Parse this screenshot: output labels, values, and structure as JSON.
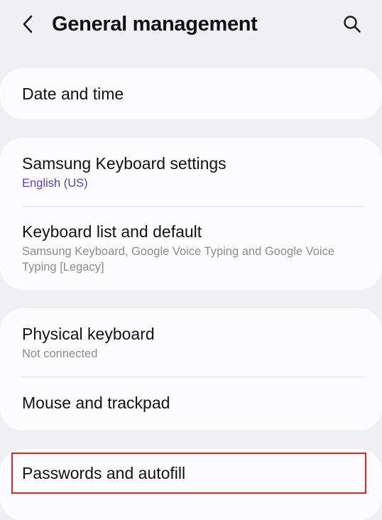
{
  "header": {
    "title": "General management",
    "back_icon": "back-chevron-icon",
    "search_icon": "search-icon"
  },
  "groups": [
    {
      "items": [
        {
          "title": "Date and time"
        }
      ]
    },
    {
      "items": [
        {
          "title": "Samsung Keyboard settings",
          "subtitle": "English (US)"
        },
        {
          "title": "Keyboard list and default",
          "subtitle": "Samsung Keyboard, Google Voice Typing and Google Voice Typing [Legacy]"
        }
      ]
    },
    {
      "items": [
        {
          "title": "Physical keyboard",
          "subtitle": "Not connected"
        },
        {
          "title": "Mouse and trackpad"
        }
      ]
    },
    {
      "items": [
        {
          "title": "Passwords and autofill"
        }
      ]
    }
  ],
  "colors": {
    "background": "#f0eff4",
    "card": "#fcfcfe",
    "accent_subtitle": "#5e3fb0",
    "highlight_border": "#e3202b"
  }
}
